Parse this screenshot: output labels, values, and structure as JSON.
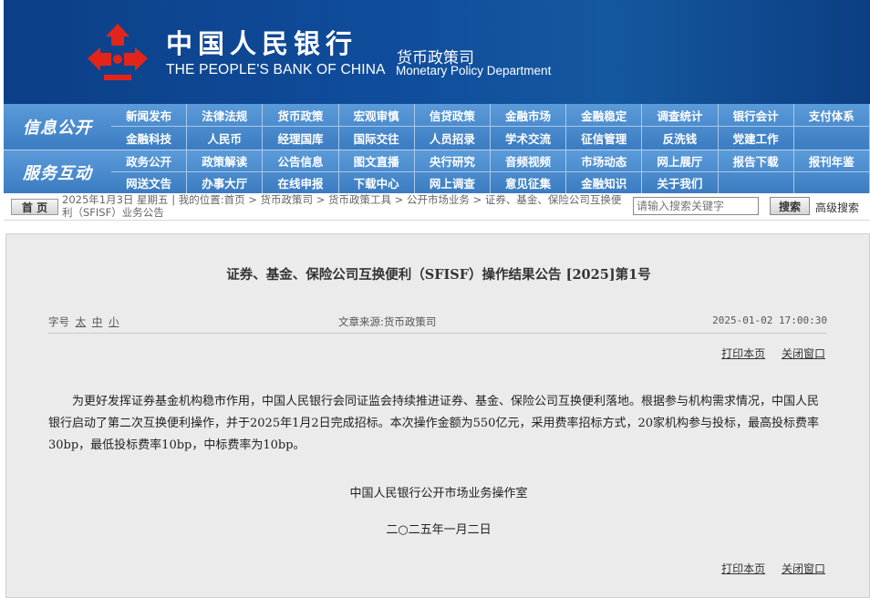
{
  "banner": {
    "cn_name": "中国人民银行",
    "en_name": "THE PEOPLE'S BANK OF CHINA",
    "dept_cn": "货币政策司",
    "dept_en": "Monetary Policy Department",
    "logo_color": "#e1251b",
    "bg_color": "#0f4d9c"
  },
  "nav": {
    "info_title": "信息公开",
    "service_title": "服务互动",
    "info_row1": [
      "新闻发布",
      "法律法规",
      "货币政策",
      "宏观审慎",
      "信贷政策",
      "金融市场",
      "金融稳定",
      "调查统计",
      "银行会计",
      "支付体系"
    ],
    "info_row2": [
      "金融科技",
      "人民币",
      "经理国库",
      "国际交往",
      "人员招录",
      "学术交流",
      "征信管理",
      "反洗钱",
      "党建工作",
      ""
    ],
    "service_row1": [
      "政务公开",
      "政策解读",
      "公告信息",
      "图文直播",
      "央行研究",
      "音频视频",
      "市场动态",
      "网上展厅",
      "报告下载",
      "报刊年鉴"
    ],
    "service_row2": [
      "网送文告",
      "办事大厅",
      "在线申报",
      "下载中心",
      "网上调查",
      "意见征集",
      "金融知识",
      "关于我们",
      "",
      ""
    ]
  },
  "crumb": {
    "home_label": "首 页",
    "text": "2025年1月3日  星期五  |  我的位置:首页   >   货币政策司   >   货币政策工具   >   公开市场业务   >   证券、基金、保险公司互换便利（SFISF）业务公告",
    "search_placeholder": "请输入搜索关键字",
    "search_button": "搜索",
    "advanced_search": "高级搜索"
  },
  "article": {
    "title": "证券、基金、保险公司互换便利（SFISF）操作结果公告 [2025]第1号",
    "font_size_label": "字号",
    "size_large": "太",
    "size_medium": "中",
    "size_small": "小",
    "source": "文章来源:货币政策司",
    "date": "2025-01-02  17:00:30",
    "print_label": "打印本页",
    "close_label": "关闭窗口",
    "body": "为更好发挥证券基金机构稳市作用，中国人民银行会同证监会持续推进证券、基金、保险公司互换便利落地。根据参与机构需求情况，中国人民银行启动了第二次互换便利操作，并于2025年1月2日完成招标。本次操作金额为550亿元，采用费率招标方式，20家机构参与投标，最高投标费率30bp，最低投标费率10bp，中标费率为10bp。",
    "signer": "中国人民银行公开市场业务操作室",
    "sign_date": "二○二五年一月二日"
  }
}
